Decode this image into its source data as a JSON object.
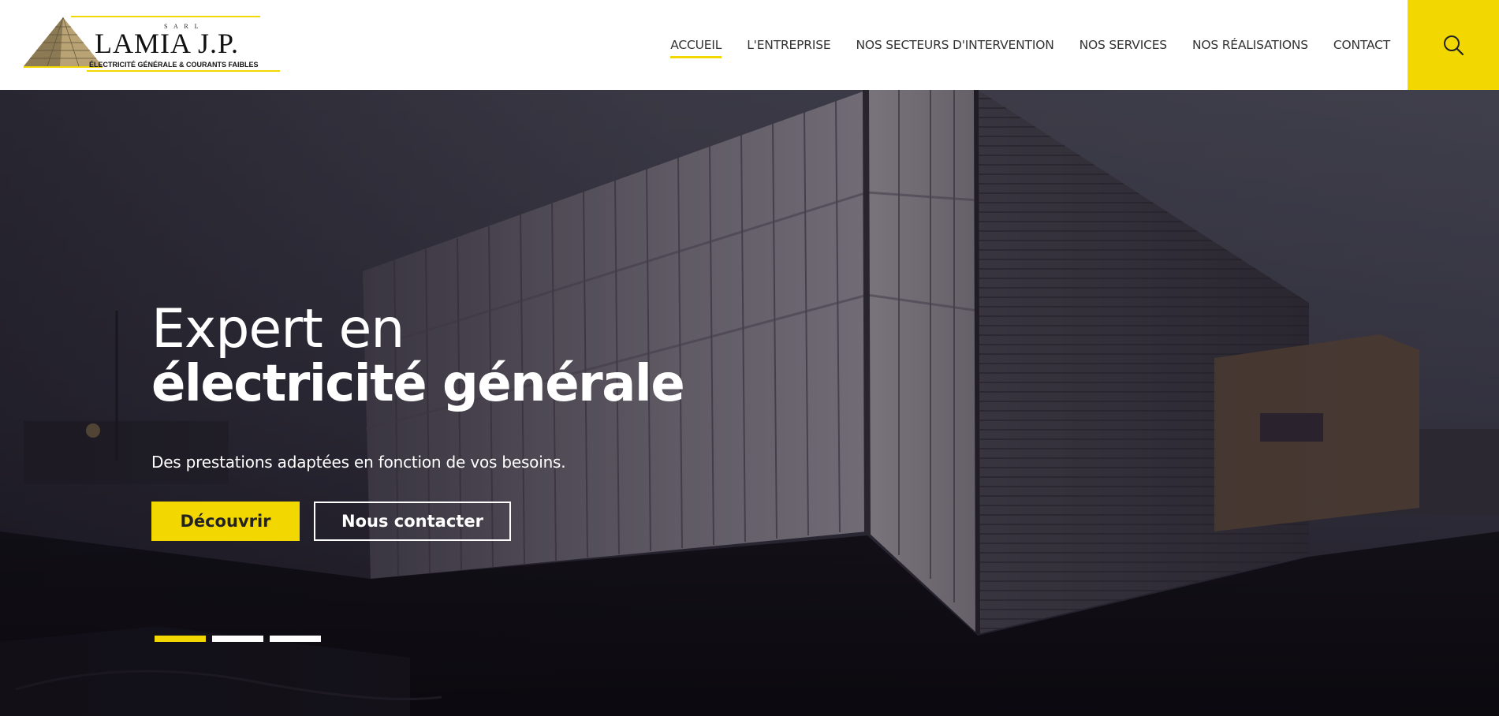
{
  "brand": {
    "tag": "S A R L",
    "name": "LAMIA J.P.",
    "tagline": "ÉLECTRICITÉ GÉNÉRALE & COURANTS FAIBLES",
    "accent_color": "#f2d800"
  },
  "nav": {
    "items": [
      {
        "label": "ACCUEIL",
        "active": true
      },
      {
        "label": "L'ENTREPRISE",
        "active": false
      },
      {
        "label": "NOS SECTEURS D'INTERVENTION",
        "active": false
      },
      {
        "label": "NOS SERVICES",
        "active": false
      },
      {
        "label": "NOS RÉALISATIONS",
        "active": false
      },
      {
        "label": "CONTACT",
        "active": false
      }
    ],
    "search_icon": "search-icon"
  },
  "hero": {
    "title_line1": "Expert en",
    "title_line2": "électricité générale",
    "subtitle": "Des prestations adaptées en fonction de vos besoins.",
    "primary_button": "Découvrir",
    "secondary_button": "Nous contacter",
    "slides": {
      "count": 3,
      "active_index": 0
    }
  }
}
